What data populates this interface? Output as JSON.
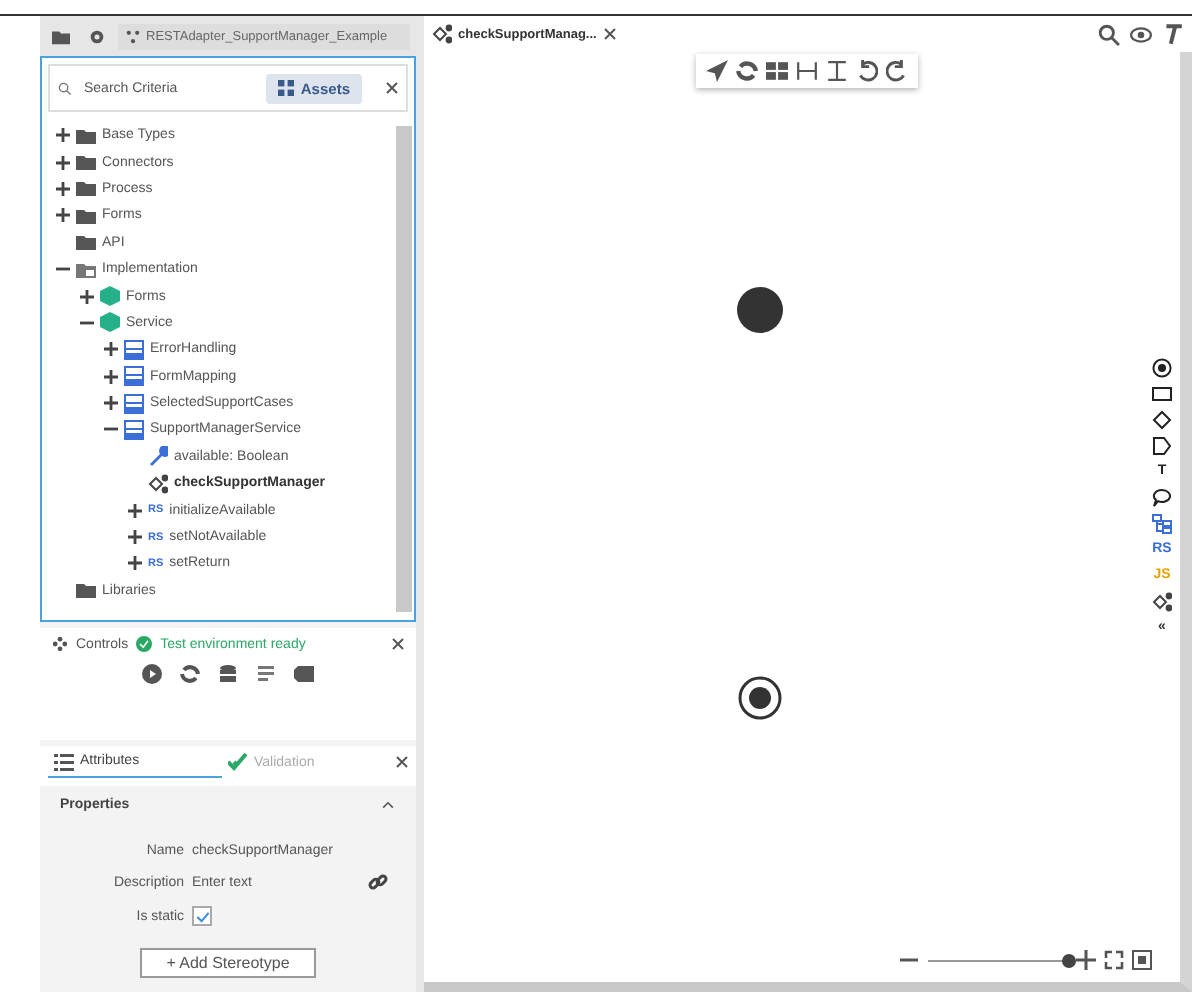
{
  "top_bar": {
    "project": "RESTAdapter_SupportManager_Example"
  },
  "search": {
    "placeholder": "Search Criteria",
    "assets_button": "Assets"
  },
  "tree": [
    {
      "label": "Base Types",
      "kind": "folder",
      "expanded": false,
      "selected": false
    },
    {
      "label": "Connectors",
      "kind": "folder",
      "expanded": false,
      "selected": false
    },
    {
      "label": "Process",
      "kind": "folder",
      "expanded": false,
      "selected": false
    },
    {
      "label": "Forms",
      "kind": "folder",
      "expanded": false,
      "selected": false
    },
    {
      "label": "API",
      "kind": "folder",
      "selected": false
    },
    {
      "label": "Implementation",
      "kind": "impl",
      "expanded": true,
      "selected": false,
      "children": [
        {
          "label": "Forms",
          "kind": "package",
          "expanded": false,
          "selected": false
        },
        {
          "label": "Service",
          "kind": "package",
          "expanded": true,
          "selected": false,
          "children": [
            {
              "label": "ErrorHandling",
              "kind": "struct",
              "expanded": false,
              "selected": false
            },
            {
              "label": "FormMapping",
              "kind": "struct",
              "expanded": false,
              "selected": false
            },
            {
              "label": "SelectedSupportCases",
              "kind": "struct",
              "expanded": false,
              "selected": false
            },
            {
              "label": "SupportManagerService",
              "kind": "struct",
              "expanded": true,
              "selected": false,
              "children": [
                {
                  "label": "available: Boolean",
                  "kind": "attribute",
                  "selected": false
                },
                {
                  "label": "checkSupportManager",
                  "kind": "process",
                  "selected": true
                },
                {
                  "label": "initializeAvailable",
                  "kind": "rule",
                  "badge": "RS",
                  "expanded": false,
                  "selected": false
                },
                {
                  "label": "setNotAvailable",
                  "kind": "rule",
                  "badge": "RS",
                  "expanded": false,
                  "selected": false
                },
                {
                  "label": "setReturn",
                  "kind": "rule",
                  "badge": "RS",
                  "expanded": false,
                  "selected": false
                }
              ]
            }
          ]
        }
      ]
    },
    {
      "label": "Libraries",
      "kind": "folder",
      "selected": false
    }
  ],
  "controls": {
    "title": "Controls",
    "status": "Test environment ready"
  },
  "panel_tabs": [
    {
      "label": "Attributes",
      "selected": true
    },
    {
      "label": "Validation",
      "selected": false
    }
  ],
  "properties": {
    "title": "Properties",
    "name_label": "Name",
    "name_value": "checkSupportManager",
    "description_label": "Description",
    "description_placeholder": "Enter text",
    "static_label": "Is static",
    "is_static": true,
    "add_button": "+ Add Stereotype"
  },
  "editor_tab": {
    "label": "checkSupportManag..."
  },
  "palette": [
    {
      "kind": "start"
    },
    {
      "kind": "task"
    },
    {
      "kind": "gateway"
    },
    {
      "kind": "intermediate"
    },
    {
      "kind": "text",
      "text": "T",
      "color": "#222222"
    },
    {
      "kind": "annotation"
    },
    {
      "kind": "subprocess"
    },
    {
      "kind": "text",
      "text": "RS",
      "color": "#3b6fd8"
    },
    {
      "kind": "text",
      "text": "JS",
      "color": "#e8a200"
    },
    {
      "kind": "process"
    },
    {
      "kind": "text",
      "text": "«",
      "color": "#333333"
    }
  ],
  "zoom": {
    "level": 1
  }
}
